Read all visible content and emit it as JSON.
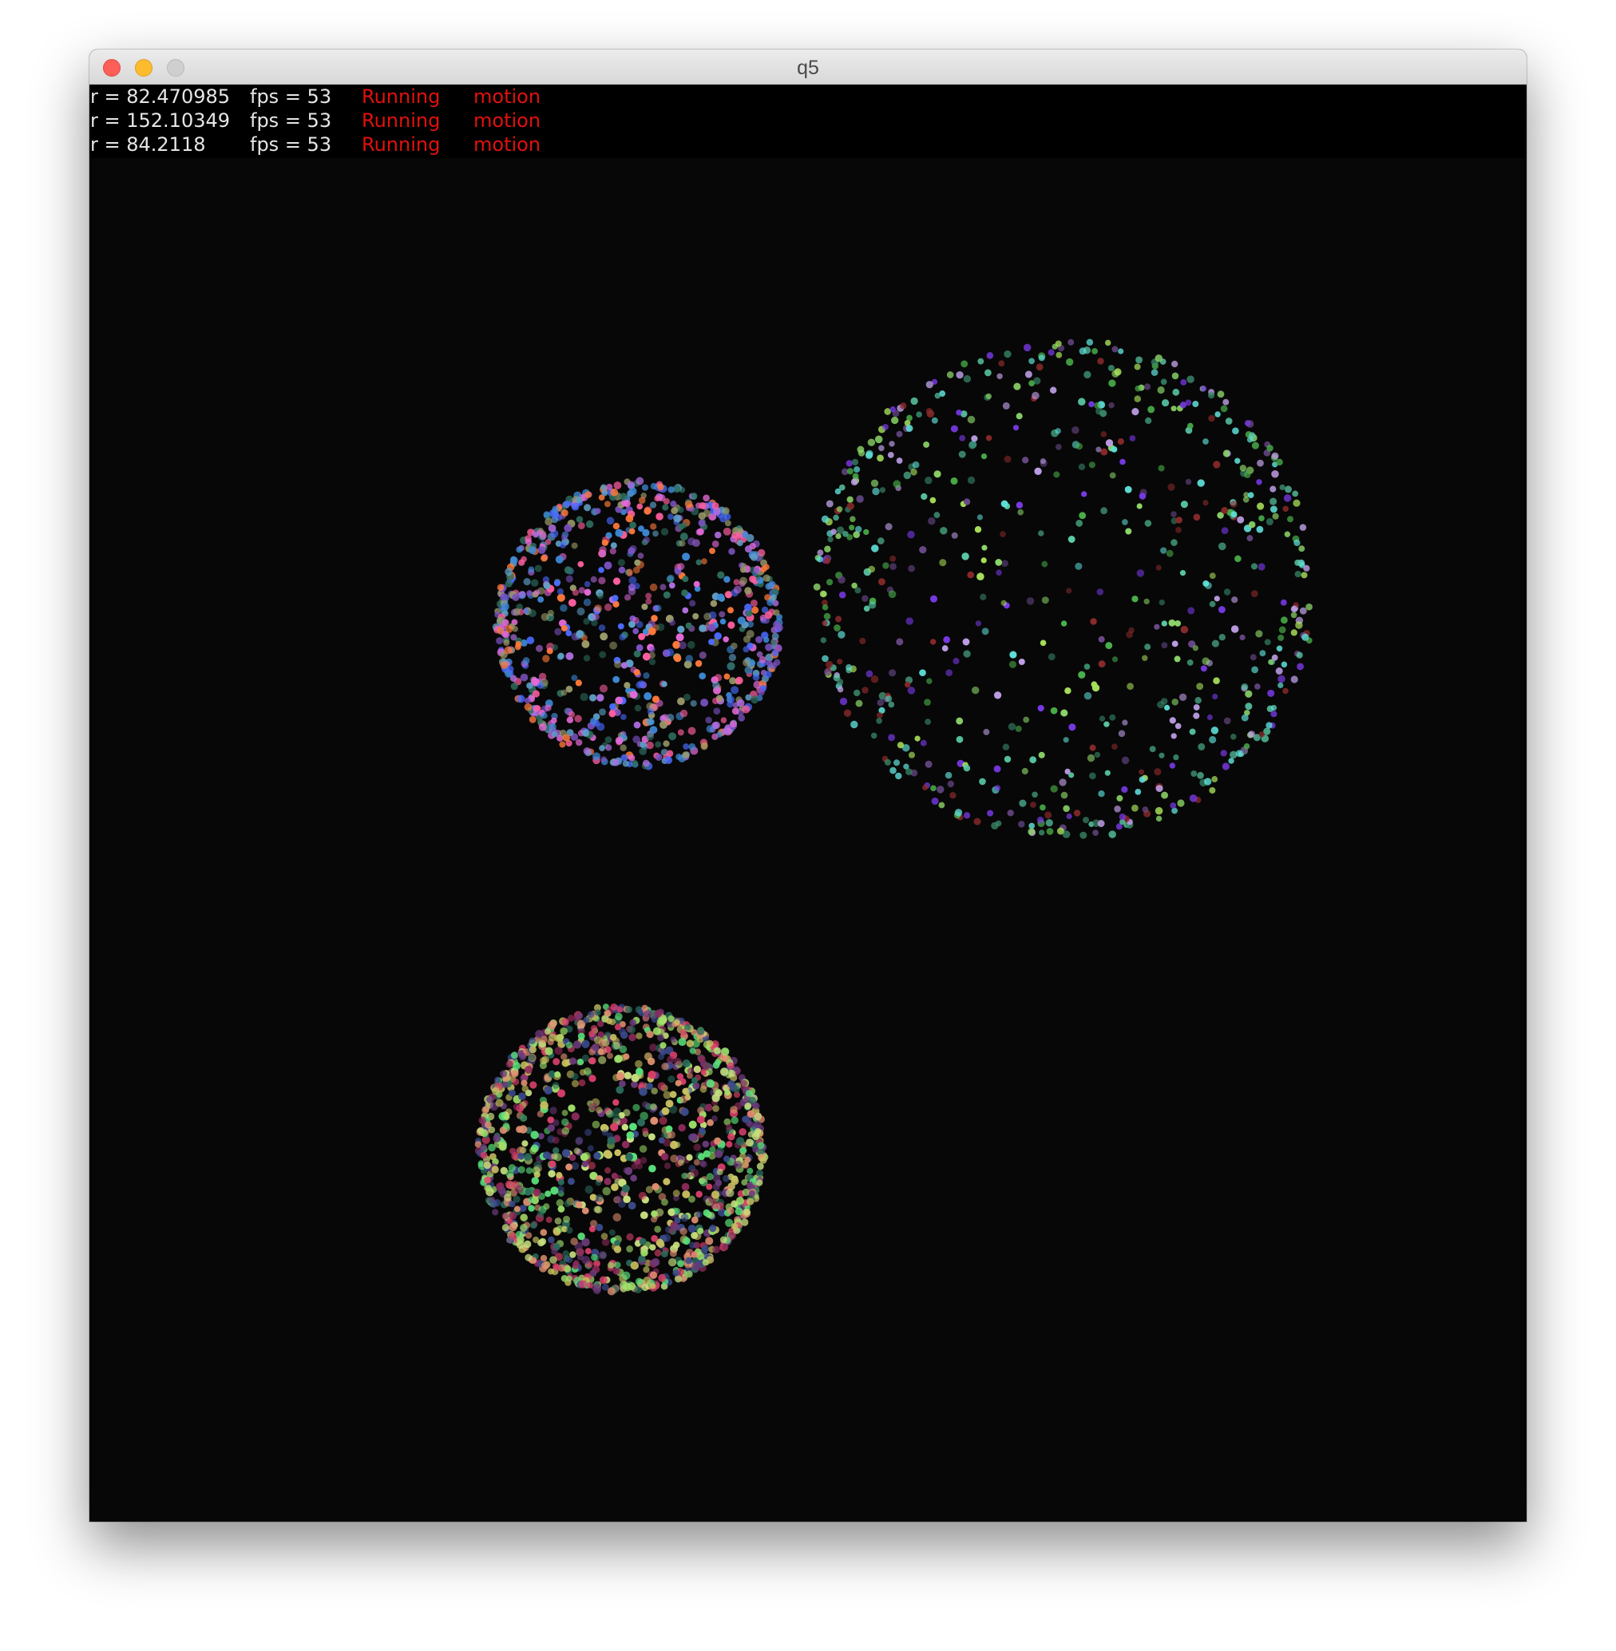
{
  "window": {
    "title": "q5"
  },
  "hud": {
    "lines": [
      {
        "r": "r = 82.470985",
        "fps": "fps = 53",
        "state": "Running",
        "mode": "motion"
      },
      {
        "r": "r = 152.10349",
        "fps": "fps = 53",
        "state": "Running",
        "mode": "motion"
      },
      {
        "r": "r = 84.2118",
        "fps": "fps = 53",
        "state": "Running",
        "mode": "motion"
      }
    ]
  },
  "spheres": [
    {
      "radius": 82.470985,
      "palette": [
        "#4a6bff",
        "#e46ad8",
        "#ff7a3a",
        "#3e8ad8",
        "#b06ee0",
        "#9a9a6a",
        "#2e6e5e",
        "#ff5fa0",
        "#7a52c0",
        "#5fa0c8"
      ]
    },
    {
      "radius": 152.10349,
      "palette": [
        "#8ed86a",
        "#5fe0d8",
        "#7a3ae8",
        "#4ab04a",
        "#c0a0e8",
        "#6a4a8a",
        "#a8e05a",
        "#3a8a6a",
        "#8a2a2a",
        "#5acaa8"
      ]
    },
    {
      "radius": 84.2118,
      "palette": [
        "#5adf7a",
        "#c8c060",
        "#d8406a",
        "#8a2a5a",
        "#3a4a8a",
        "#a0e06a",
        "#e09070",
        "#2a6a5a",
        "#6a3a7a",
        "#c8e080"
      ]
    }
  ],
  "colors": {
    "background": "#070707",
    "hud_background": "#000000",
    "hud_text": "#e6e6e6",
    "hud_status": "#e0110d"
  }
}
